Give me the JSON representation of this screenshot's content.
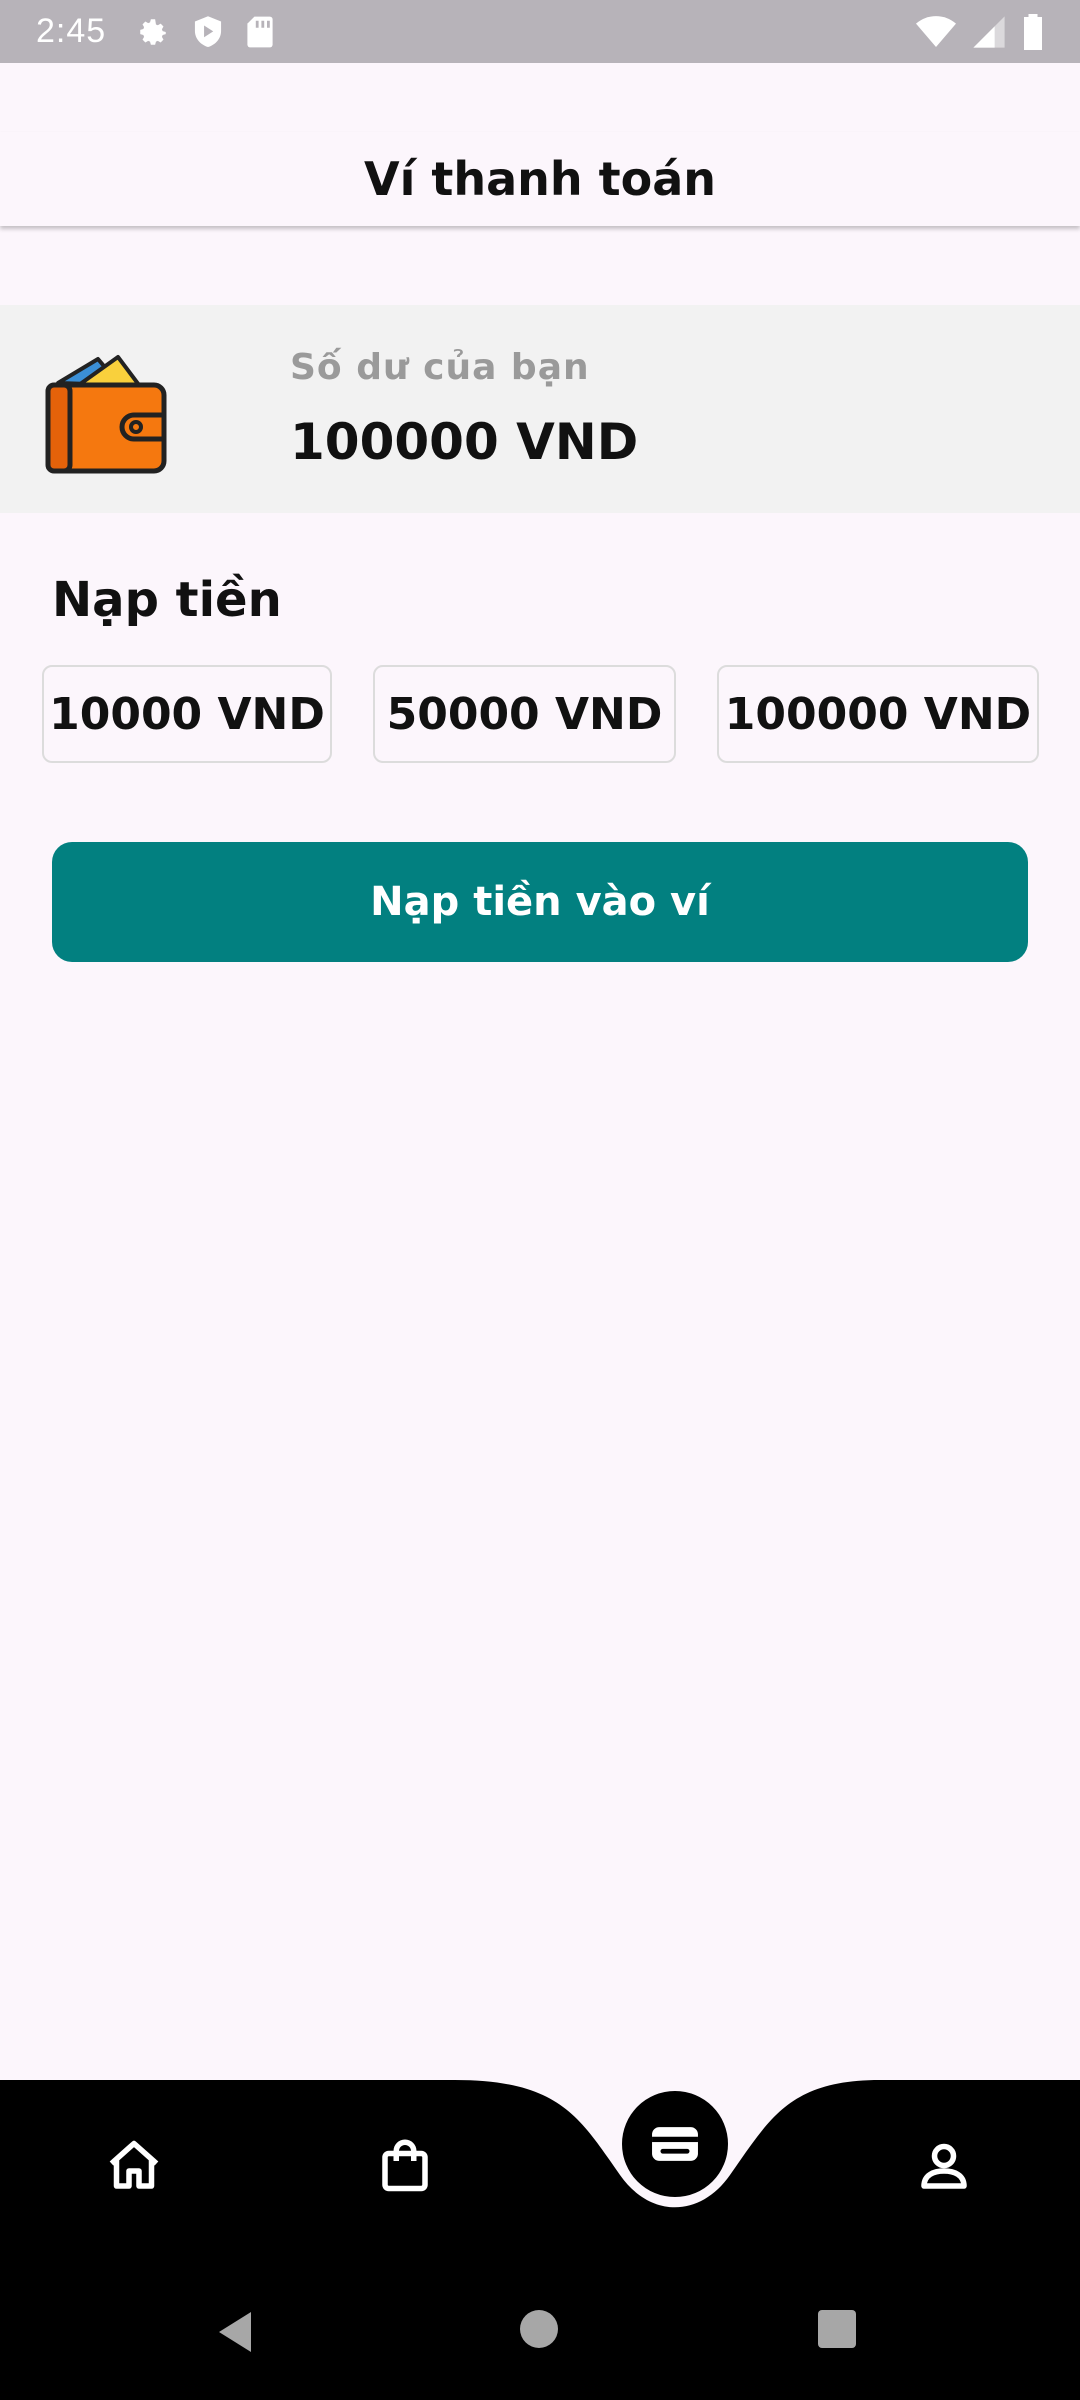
{
  "status_bar": {
    "time": "2:45",
    "left_icons": [
      "settings-icon",
      "shield-play-icon",
      "sd-card-icon"
    ],
    "right_icons": [
      "wifi-icon",
      "signal-icon",
      "battery-icon"
    ]
  },
  "app_bar": {
    "title": "Ví thanh toán"
  },
  "balance": {
    "icon": "wallet-icon",
    "label": "Số dư của bạn",
    "value": "100000 VND"
  },
  "topup": {
    "heading": "Nạp tiền",
    "amounts": [
      "10000 VND",
      "50000 VND",
      "100000 VND"
    ],
    "button_label": "Nạp tiền vào ví"
  },
  "bottom_nav": {
    "items": [
      "home-icon",
      "shopping-bag-icon",
      "wallet-icon",
      "profile-icon"
    ],
    "active": "wallet-icon"
  },
  "colors": {
    "accent": "#028080",
    "wallet_orange": "#f5780f",
    "background": "#fcf6fc",
    "nav_background": "#000000"
  }
}
